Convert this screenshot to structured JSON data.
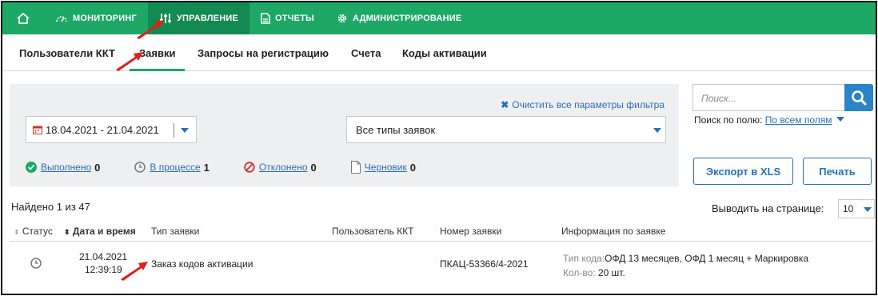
{
  "topnav": {
    "items": [
      {
        "label": "МОНИТОРИНГ",
        "icon": "gauge-icon"
      },
      {
        "label": "УПРАВЛЕНИЕ",
        "icon": "sliders-icon"
      },
      {
        "label": "ОТЧЕТЫ",
        "icon": "document-icon"
      },
      {
        "label": "АДМИНИСТРИРОВАНИЕ",
        "icon": "gear-icon"
      }
    ],
    "active": "УПРАВЛЕНИЕ",
    "colors": {
      "bar": "#1ea866",
      "active": "#128a52"
    }
  },
  "subnav": {
    "items": [
      "Пользователи ККТ",
      "Заявки",
      "Запросы на регистрацию",
      "Счета",
      "Коды активации"
    ],
    "active": "Заявки"
  },
  "filter": {
    "clear_label": "Очистить все параметры фильтра",
    "date_range": "18.04.2021 - 21.04.2021",
    "type_select": "Все типы заявок",
    "stats": [
      {
        "label": "Выполнено",
        "count": "0",
        "icon": "check-circle-icon"
      },
      {
        "label": "В процессе",
        "count": "1",
        "icon": "clock-icon"
      },
      {
        "label": "Отклонено",
        "count": "0",
        "icon": "forbidden-icon"
      },
      {
        "label": "Черновик",
        "count": "0",
        "icon": "draft-document-icon"
      }
    ]
  },
  "search": {
    "placeholder": "Поиск...",
    "field_label": "Поиск по полю:",
    "field_value": "По всем полям",
    "export_label": "Экспорт в XLS",
    "print_label": "Печать"
  },
  "results": {
    "found": "Найдено 1 из 47",
    "per_page_label": "Выводить на странице:",
    "per_page_value": "10"
  },
  "table": {
    "headers": [
      "Статус",
      "Дата и время",
      "Тип заявки",
      "Пользователь ККТ",
      "Номер заявки",
      "Информация по заявке"
    ],
    "rows": [
      {
        "status_icon": "clock-icon",
        "date": "21.04.2021",
        "time": "12:39:19",
        "type": "Заказ кодов активации",
        "user": "",
        "number": "ПКАЦ-53366/4-2021",
        "info_type_label": "Тип кода:",
        "info_type_value": "ОФД 13 месяцев, ОФД 1 месяц + Маркировка",
        "info_qty_label": "Кол-во:",
        "info_qty_value": "20 шт."
      }
    ]
  },
  "accent_colors": {
    "link": "#2a6fb7",
    "annotation_arrow": "#e0201b"
  }
}
